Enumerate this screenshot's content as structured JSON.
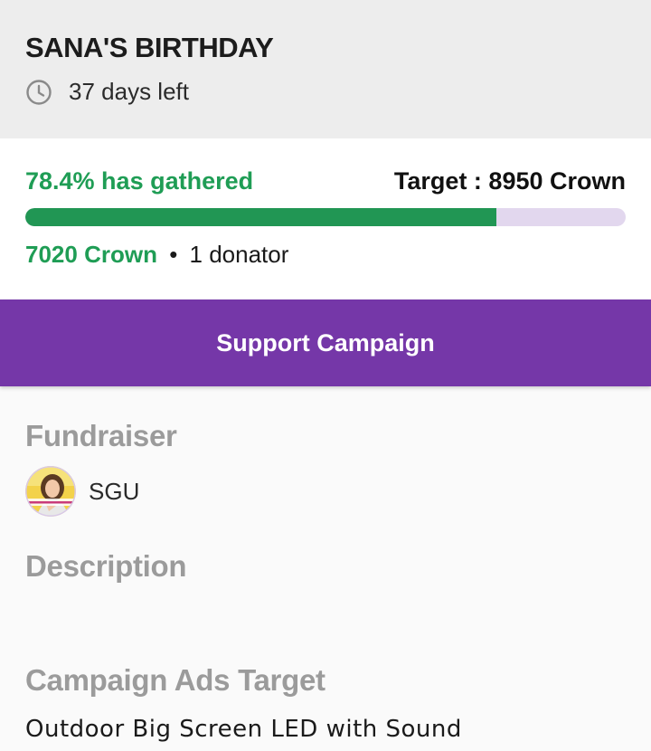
{
  "campaign": {
    "title": "SANA'S BIRTHDAY",
    "days_left": "37 days left"
  },
  "progress": {
    "percent_label": "78.4% has gathered",
    "target_label": "Target : 8950 Crown",
    "fraction": 0.784,
    "collected_label": "7020 Crown",
    "separator": "•",
    "donator_label": "1 donator"
  },
  "actions": {
    "support_label": "Support Campaign"
  },
  "fundraiser": {
    "heading": "Fundraiser",
    "name": "SGU"
  },
  "description": {
    "heading": "Description"
  },
  "ads_target": {
    "heading": "Campaign Ads Target",
    "value": "Outdoor Big Screen LED with Sound"
  },
  "colors": {
    "accent_green": "#1f9d55",
    "button_purple": "#7537a8",
    "track_lavender": "#e2d7ee"
  }
}
